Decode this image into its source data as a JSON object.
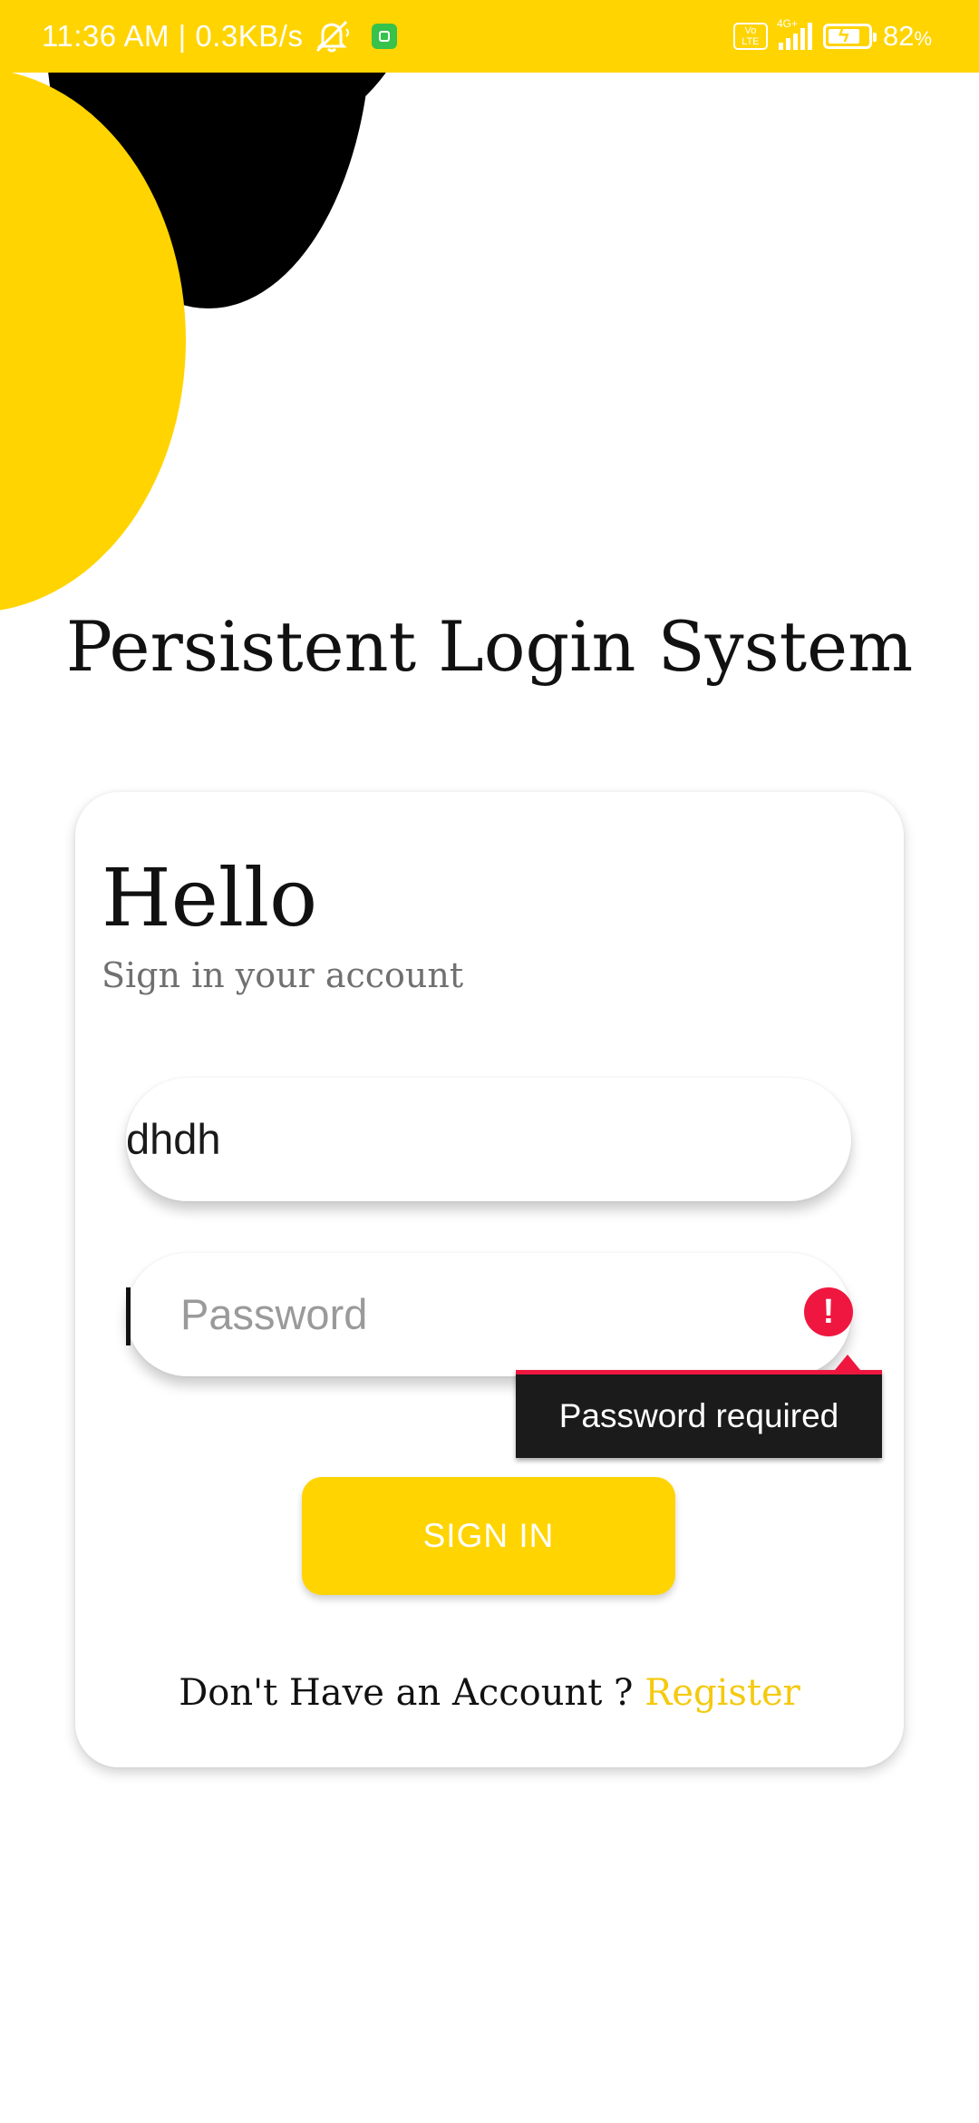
{
  "status_bar": {
    "time_speed": "11:36 AM | 0.3KB/s",
    "volte_top": "Vo",
    "volte_bottom": "LTE",
    "network": "4G+",
    "battery": "82",
    "battery_unit": "%",
    "battery_level": 0.82
  },
  "app": {
    "title": "Persistent Login System"
  },
  "card": {
    "greeting": "Hello",
    "subtitle": "Sign in your account",
    "username_value": "dhdh",
    "password_placeholder": "Password",
    "password_error": "Password required",
    "error_icon_glyph": "!",
    "signin_label": "SIGN IN",
    "register_prompt": "Don't Have an Account ?",
    "register_link": "Register"
  },
  "colors": {
    "accent": "#FFD400",
    "error": "#EF1740",
    "tooltip_bg": "#1B1B1B"
  },
  "icons": {
    "mute": "bell-off-icon",
    "app": "notification-app-icon",
    "error": "error-icon"
  }
}
